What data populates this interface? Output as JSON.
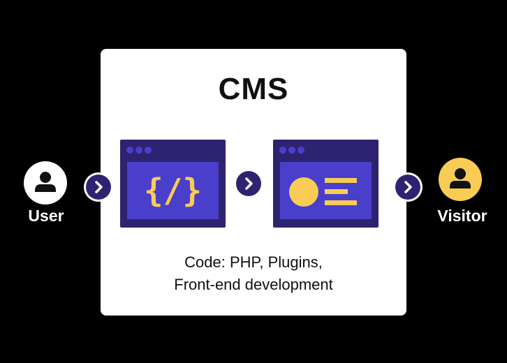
{
  "title": "CMS",
  "caption": {
    "line1": "Code: PHP, Plugins,",
    "line2": "Front-end development"
  },
  "user": {
    "label": "User",
    "icon": "person-icon",
    "color": "#ffffff"
  },
  "visitor": {
    "label": "Visitor",
    "icon": "person-icon",
    "color": "#f8cc55"
  },
  "code_window": {
    "icon": "code-icon",
    "glyph": "{/}"
  },
  "page_window": {
    "icon": "layout-icon"
  },
  "arrows": [
    "chevron-right-icon",
    "chevron-right-icon",
    "chevron-right-icon"
  ],
  "colors": {
    "background": "#000000",
    "panel": "#ffffff",
    "window_frame": "#2e2370",
    "window_content": "#4a3fcb",
    "accent_yellow": "#f8cc55"
  }
}
